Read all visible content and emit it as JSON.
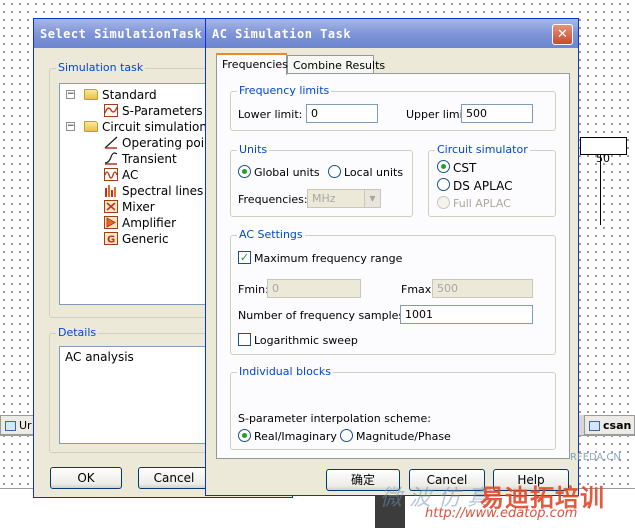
{
  "background": {
    "box_value": "50",
    "tab_left": "Ur",
    "tab_right": "csan"
  },
  "select_dialog": {
    "title": "Select SimulationTask",
    "group_title": "Simulation task",
    "tree": [
      {
        "label": "Standard",
        "icon": "folder-icon",
        "expanded": true
      },
      {
        "label": "S-Parameters",
        "icon": "s-parameters-icon"
      },
      {
        "label": "Circuit simulation",
        "icon": "folder-icon",
        "expanded": true
      },
      {
        "label": "Operating point",
        "icon": "operating-point-icon"
      },
      {
        "label": "Transient",
        "icon": "transient-icon"
      },
      {
        "label": "AC",
        "icon": "ac-icon"
      },
      {
        "label": "Spectral lines",
        "icon": "spectral-lines-icon"
      },
      {
        "label": "Mixer",
        "icon": "mixer-icon"
      },
      {
        "label": "Amplifier",
        "icon": "amplifier-icon"
      },
      {
        "label": "Generic",
        "icon": "generic-icon"
      }
    ],
    "details_title": "Details",
    "details_text": "AC analysis",
    "ok_label": "OK",
    "cancel_label": "Cancel"
  },
  "ac_dialog": {
    "title": "AC Simulation Task",
    "close_glyph": "✕",
    "tabs": [
      "Frequencies",
      "Combine Results"
    ],
    "freq_limits": {
      "title": "Frequency limits",
      "lower_label": "Lower limit:",
      "lower_value": "0",
      "upper_label": "Upper limit:",
      "upper_value": "500"
    },
    "units": {
      "title": "Units",
      "global_label": "Global units",
      "local_label": "Local units",
      "freq_label": "Frequencies:",
      "freq_value": "MHz"
    },
    "circuit_simulator": {
      "title": "Circuit simulator",
      "cst_label": "CST",
      "ds_aplac_label": "DS APLAC",
      "full_aplac_label": "Full APLAC"
    },
    "ac_settings": {
      "title": "AC Settings",
      "max_freq_label": "Maximum frequency range",
      "fmin_label": "Fmin:",
      "fmin_value": "0",
      "fmax_label": "Fmax:",
      "fmax_value": "500",
      "samples_label": "Number of frequency samples:",
      "samples_value": "1001",
      "log_sweep_label": "Logarithmic sweep"
    },
    "individual_blocks": {
      "title": "Individual blocks",
      "scheme_label": "S-parameter interpolation scheme:",
      "real_imag_label": "Real/Imaginary",
      "mag_phase_label": "Magnitude/Phase"
    },
    "buttons": {
      "ok": "确定",
      "cancel": "Cancel",
      "help": "Help"
    }
  },
  "watermark": {
    "brand": "易迪拓培训",
    "url": "http://www.edatop.com",
    "rfeda": "RFEDA.CN",
    "overlay": "微 波 仿 真"
  }
}
